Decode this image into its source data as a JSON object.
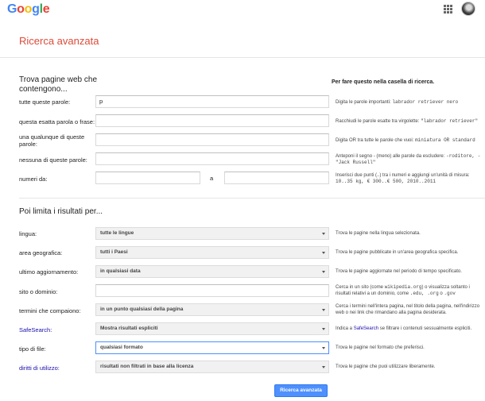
{
  "header": {
    "logo_letters": [
      {
        "ch": "G",
        "color": "#4285f4"
      },
      {
        "ch": "o",
        "color": "#ea4335"
      },
      {
        "ch": "o",
        "color": "#fbbc05"
      },
      {
        "ch": "g",
        "color": "#4285f4"
      },
      {
        "ch": "l",
        "color": "#34a853"
      },
      {
        "ch": "e",
        "color": "#ea4335"
      }
    ],
    "apps_icon": "apps-grid-icon",
    "avatar_icon": "user-avatar"
  },
  "title": "Ricerca avanzata",
  "find": {
    "heading": "Trova pagine web che contengono...",
    "column_heading": "Per fare questo nella casella di ricerca.",
    "all_words": {
      "label": "tutte queste parole:",
      "value": "p",
      "hint": "Digita le parole importanti:",
      "hint_code": "labrador retriever nero"
    },
    "exact_phrase": {
      "label": "questa esatta parola o frase:",
      "value": "",
      "hint": "Racchiudi le parole esatte tra virgolette:",
      "hint_code": "\"labrador retriever\""
    },
    "any_words": {
      "label": "una qualunque di queste parole:",
      "value": "",
      "hint": "Digita OR tra tutte le parole che vuoi:",
      "hint_code": "miniatura OR standard"
    },
    "none_words": {
      "label": "nessuna di queste parole:",
      "value": "",
      "hint": "Anteponi il segno - (meno) alle parole da escludere:",
      "hint_code": "-roditore, -\"Jack Russell\""
    },
    "numbers": {
      "label": "numeri da:",
      "from": "",
      "to_label": "a",
      "to": "",
      "hint": "Inserisci due punti (..) tra i numeri e aggiungi un'unità di misura:",
      "hint_code": "10..35 kg, € 300..€ 500, 2010..2011"
    }
  },
  "narrow": {
    "heading": "Poi limita i risultati per...",
    "language": {
      "label": "lingua:",
      "value": "tutte le lingue",
      "hint": "Trova le pagine nella lingua selezionata."
    },
    "region": {
      "label": "area geografica:",
      "value": "tutti i Paesi",
      "hint": "Trova le pagine pubblicate in un'area geografica specifica."
    },
    "last_update": {
      "label": "ultimo aggiornamento:",
      "value": "in qualsiasi data",
      "hint": "Trova le pagine aggiornate nel periodo di tempo specificato."
    },
    "site": {
      "label": "sito o dominio:",
      "value": "",
      "hint_pre": "Cerca in un sito (come",
      "hint_code1": "wikipedia.org",
      "hint_mid": ") o visualizza soltanto i risultati relativi a un dominio, come",
      "hint_code2": ".edu, .org",
      "hint_o": "o",
      "hint_code3": ".gov"
    },
    "terms_appear": {
      "label": "termini che compaiono:",
      "value": "in un punto qualsiasi della pagina",
      "hint": "Cerca i termini nell'intera pagina, nel titolo della pagina, nell'indirizzo web o nei link che rimandano alla pagina desiderata."
    },
    "safesearch": {
      "label": "SafeSearch:",
      "value": "Mostra risultati espliciti",
      "hint_pre": "Indica a",
      "hint_link": "SafeSearch",
      "hint_post": "se filtrare i contenuti sessualmente espliciti."
    },
    "file_type": {
      "label": "tipo di file:",
      "value": "qualsiasi formato",
      "hint": "Trova le pagine nel formato che preferisci."
    },
    "usage_rights": {
      "label": "diritti di utilizzo:",
      "value": "risultati non filtrati in base alla licenza",
      "hint": "Trova le pagine che puoi utilizzare liberamente."
    }
  },
  "submit_label": "Ricerca avanzata",
  "colors": {
    "accent": "#dd4b39",
    "link": "#1a0dab",
    "button": "#4d90fe"
  }
}
